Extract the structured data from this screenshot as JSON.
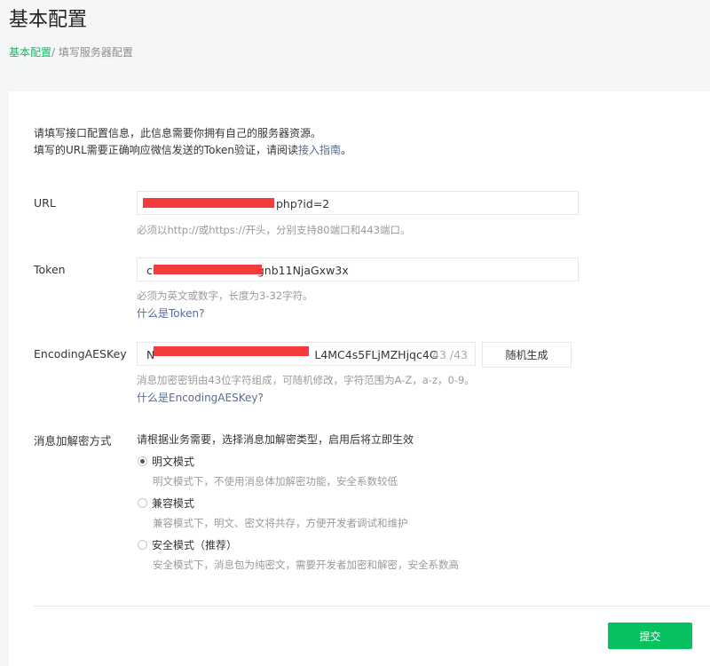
{
  "page": {
    "title": "基本配置",
    "breadcrumb": {
      "active": "基本配置",
      "separator": "/ ",
      "current": "填写服务器配置"
    }
  },
  "intro": {
    "line1": "请填写接口配置信息，此信息需要你拥有自己的服务器资源。",
    "line2_prefix": "填写的URL需要正确响应微信发送的Token验证，请阅读",
    "line2_link": "接入指南",
    "line2_suffix": "。"
  },
  "form": {
    "url": {
      "label": "URL",
      "value_visible": "php?id=2",
      "hint": "必须以http://或https://开头，分别支持80端口和443端口。"
    },
    "token": {
      "label": "Token",
      "value_prefix": "c",
      "value_visible": "gnb11NjaGxw3x",
      "hint": "必须为英文或数字，长度为3-32字符。",
      "help_link": "什么是Token?"
    },
    "aes_key": {
      "label": "EncodingAESKey",
      "value_prefix": "N",
      "value_visible": "L4MC4s5FLjMZHjqc4C",
      "counter": "43 /43",
      "generate_button": "随机生成",
      "hint": "消息加密密钥由43位字符组成，可随机修改，字符范围为A-Z，a-z，0-9。",
      "help_link": "什么是EncodingAESKey?"
    },
    "encryption": {
      "label": "消息加解密方式",
      "instruction": "请根据业务需要，选择消息加解密类型，启用后将立即生效",
      "options": [
        {
          "label": "明文模式",
          "desc": "明文模式下，不使用消息体加解密功能，安全系数较低",
          "checked": true
        },
        {
          "label": "兼容模式",
          "desc": "兼容模式下，明文、密文将共存，方便开发者调试和维护",
          "checked": false
        },
        {
          "label": "安全模式（推荐）",
          "desc": "安全模式下，消息包为纯密文，需要开发者加密和解密，安全系数高",
          "checked": false
        }
      ]
    }
  },
  "actions": {
    "submit": "提交"
  },
  "colors": {
    "accent": "#07c160",
    "link": "#576b95",
    "redaction": "#f53b3b"
  }
}
